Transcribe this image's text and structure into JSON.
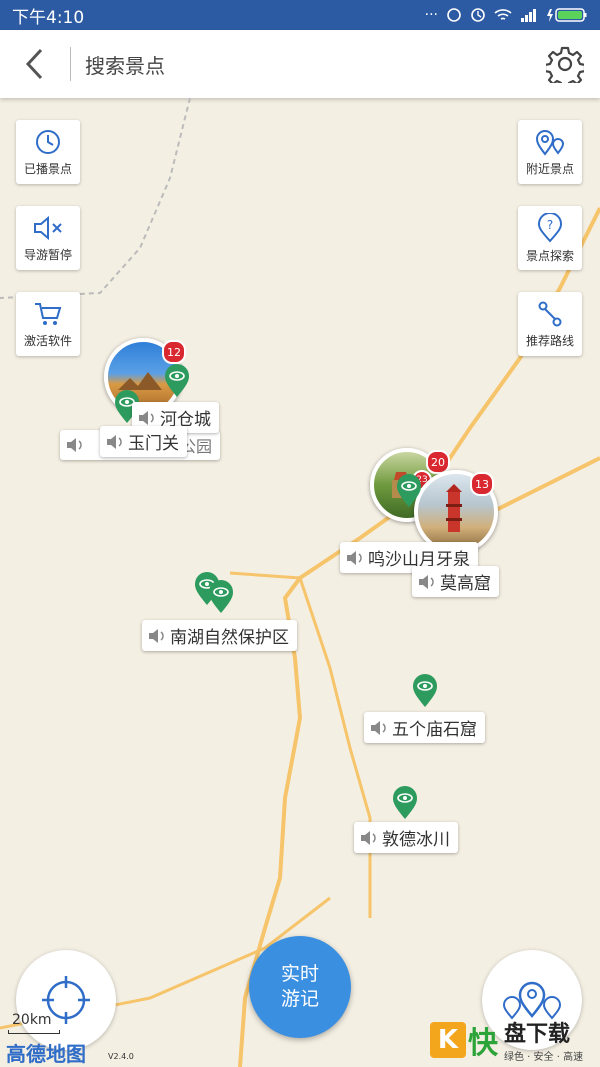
{
  "status": {
    "time": "下午4:10",
    "dots": "···"
  },
  "header": {
    "search_placeholder": "搜索景点"
  },
  "left_buttons": [
    {
      "label": "已播景点",
      "icon": "history-icon"
    },
    {
      "label": "导游暂停",
      "icon": "mute-icon"
    },
    {
      "label": "激活软件",
      "icon": "cart-icon"
    }
  ],
  "right_buttons": [
    {
      "label": "附近景点",
      "icon": "nearby-pin-icon"
    },
    {
      "label": "景点探索",
      "icon": "question-pin-icon"
    },
    {
      "label": "推荐路线",
      "icon": "route-icon"
    }
  ],
  "clusters": [
    {
      "count": "12"
    },
    {
      "count": "20"
    },
    {
      "count": "23"
    },
    {
      "count": "13"
    }
  ],
  "spots": [
    {
      "name": "河仓城"
    },
    {
      "name": "玉门关"
    },
    {
      "name": "公园"
    },
    {
      "name": "鸣沙山月牙泉"
    },
    {
      "name": "莫高窟"
    },
    {
      "name": "南湖自然保护区"
    },
    {
      "name": "五个庙石窟"
    },
    {
      "name": "敦德冰川"
    }
  ],
  "fab": {
    "line1": "实时",
    "line2": "游记"
  },
  "map_footer": {
    "scale": "20km",
    "provider": "高德地图",
    "version": "V2.4.0"
  },
  "watermark": {
    "k": "K",
    "kuai": "快",
    "title": "盘下载",
    "slogan": "绿色 · 安全 · 高速"
  },
  "colors": {
    "statusbar": "#2d5ba3",
    "pin": "#2e9b5e",
    "badge": "#d9282f",
    "fab": "#3b8fe0",
    "road": "#f6c46a"
  }
}
